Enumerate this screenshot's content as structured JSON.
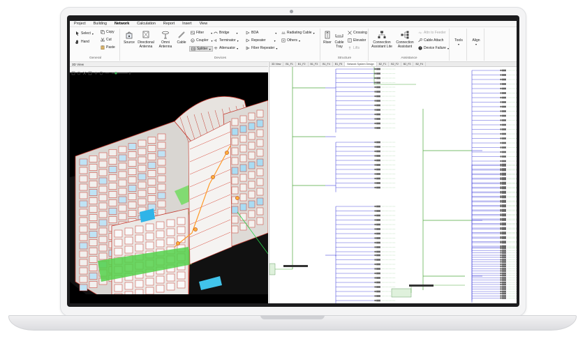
{
  "menu": [
    "Project",
    "Building",
    "Network",
    "Calculation",
    "Report",
    "Insert",
    "View"
  ],
  "menu_active": "Network",
  "ribbon": {
    "general": {
      "label": "General",
      "select": "Select",
      "hand": "Hand",
      "copy": "Copy",
      "cut": "Cut",
      "paste": "Paste"
    },
    "devices": {
      "label": "Devices",
      "source": "Source",
      "directional": "Directional Antenna",
      "omni": "Omni Antenna",
      "cable": "Cable",
      "filter": "Filter",
      "coupler": "Coupler",
      "splitter": "Splitter",
      "bridge": "Bridge",
      "terminator": "Terminator",
      "attenuator": "Attenuator",
      "bda": "BDA",
      "repeater": "Repeater",
      "fiber_repeater": "Fiber Repeater",
      "radiating_cable": "Radiating Cable",
      "others": "Others"
    },
    "structure": {
      "label": "Structure",
      "riser": "Riser",
      "cable_tray": "Cable Tray",
      "crossing": "Crossing",
      "elevator": "Elevator",
      "lifts": "Lifts"
    },
    "assistance": {
      "label": "Assistance",
      "cal": "Connection Assistant Lite",
      "ca": "Connection Assistant",
      "attn_feeder": "Attn to Feeder",
      "cable_attach": "Cable Attach",
      "device_failure": "Device Failure"
    },
    "tools": "Tools",
    "align": "Align"
  },
  "view3d": {
    "title": "3D View"
  },
  "schematic": {
    "tabs": [
      "3D View",
      "B1_F1",
      "B1_F2",
      "B1_F3",
      "B1_F4",
      "B1_F5",
      "Network System Design",
      "B2_F1",
      "B2_F2",
      "B2_F3",
      "B2_F4"
    ],
    "active_tab": "Network System Design"
  },
  "colors": {
    "accent": "#1f6fb5",
    "schematic_line": "#2b2bd6",
    "riser_line": "#4fa83d",
    "box": "#e23b2e"
  }
}
